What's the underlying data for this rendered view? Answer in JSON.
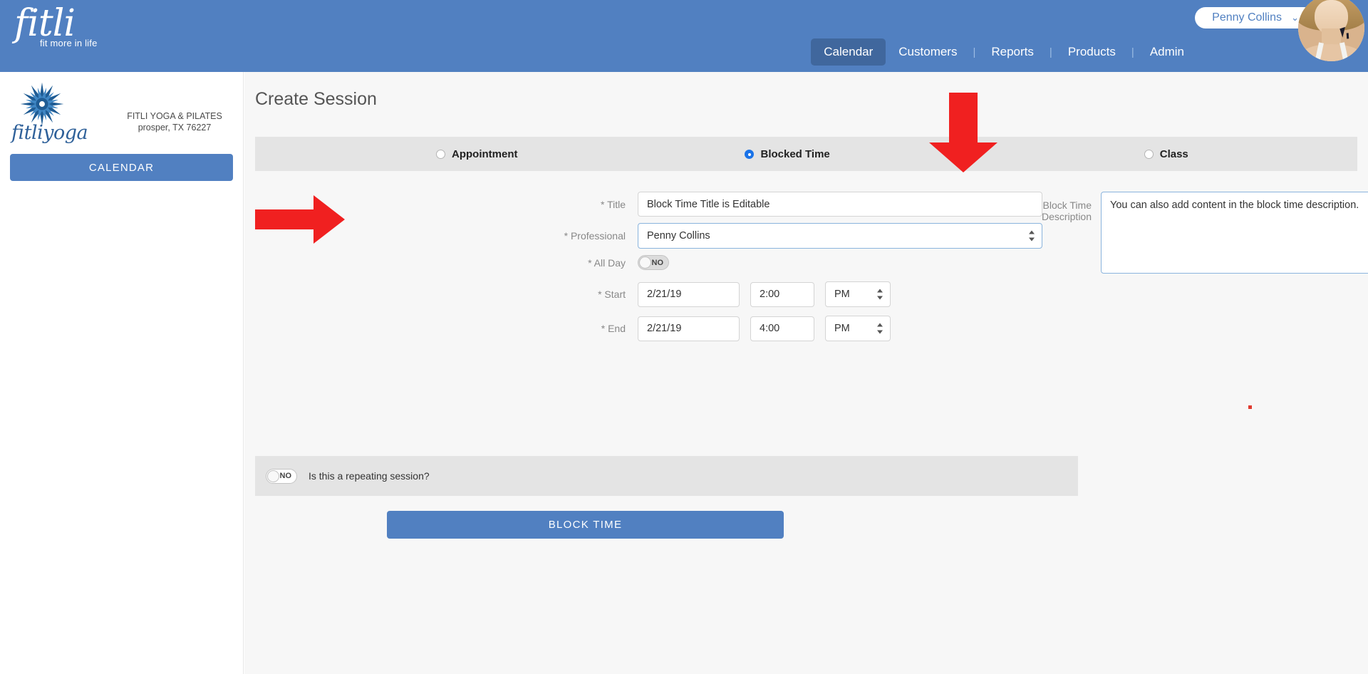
{
  "header": {
    "logo_word": "fitli",
    "logo_tagline": "fit more in life",
    "nav": [
      {
        "label": "Calendar",
        "active": true
      },
      {
        "label": "Customers",
        "active": false
      },
      {
        "label": "Reports",
        "active": false
      },
      {
        "label": "Products",
        "active": false
      },
      {
        "label": "Admin",
        "active": false
      }
    ],
    "separator": "|",
    "user_name": "Penny Collins",
    "user_chevron": "chevron-down-icon"
  },
  "sidebar": {
    "brand": "fitliyoga",
    "business_name": "FITLI YOGA & PILATES",
    "business_location": "prosper, TX 76227",
    "calendar_button": "CALENDAR"
  },
  "main": {
    "page_title": "Create Session",
    "session_types": [
      {
        "label": "Appointment",
        "selected": false
      },
      {
        "label": "Blocked Time",
        "selected": true
      },
      {
        "label": "Class",
        "selected": false
      }
    ],
    "form": {
      "title_label": "* Title",
      "title_value": "Block Time Title is Editable",
      "professional_label": "* Professional",
      "professional_value": "Penny Collins",
      "all_day_label": "* All Day",
      "all_day_value": "NO",
      "start_label": "* Start",
      "start_date": "2/21/19",
      "start_time": "2:00",
      "start_ampm": "PM",
      "end_label": "* End",
      "end_date": "2/21/19",
      "end_time": "4:00",
      "end_ampm": "PM",
      "description_label": "Block Time Description",
      "description_value": "You can also add content in the block time description."
    },
    "repeating": {
      "toggle_value": "NO",
      "question": "Is this a repeating session?"
    },
    "submit_button": "BLOCK TIME"
  },
  "colors": {
    "header_blue": "#5180c1",
    "nav_active": "#40679d",
    "accent_button": "#5180c1",
    "radio_selected": "#1a73e8",
    "annotation_red": "#f02020",
    "panel_bg": "#f7f7f7",
    "bar_bg": "#e4e4e4"
  }
}
